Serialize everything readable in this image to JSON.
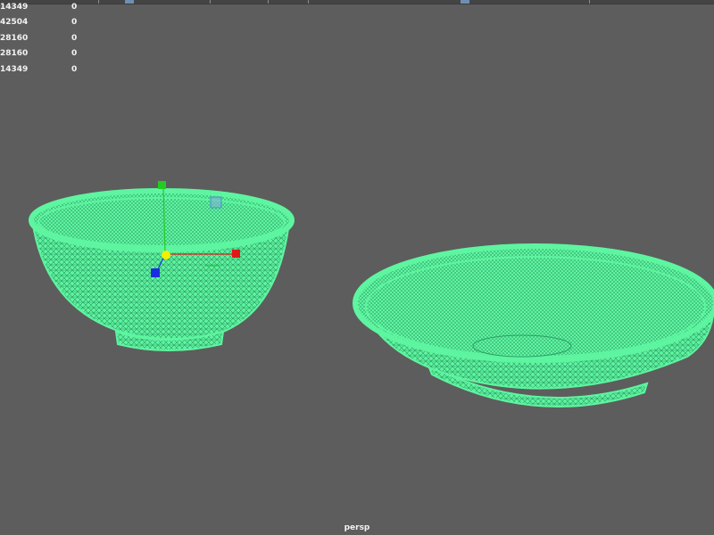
{
  "hud": {
    "rows": [
      {
        "a": "14349",
        "b": "0"
      },
      {
        "a": "42504",
        "b": "0"
      },
      {
        "a": "28160",
        "b": "0"
      },
      {
        "a": "28160",
        "b": "0"
      },
      {
        "a": "14349",
        "b": "0"
      }
    ]
  },
  "viewport": {
    "camera": "persp",
    "background": "#5d5d5d",
    "wireframe_color": "#5ef5a0",
    "mesh_line_color": "#2e9c66"
  },
  "objects": [
    {
      "name": "bowl",
      "selected": true
    },
    {
      "name": "plate",
      "selected": true
    }
  ],
  "manipulator": {
    "colors": {
      "x": "#e01818",
      "y": "#22cc22",
      "z": "#1a2ee0",
      "center": "#f0f000",
      "plane": "#7fb0d6"
    }
  },
  "icons": {
    "move_tool": "move-manipulator-icon"
  }
}
